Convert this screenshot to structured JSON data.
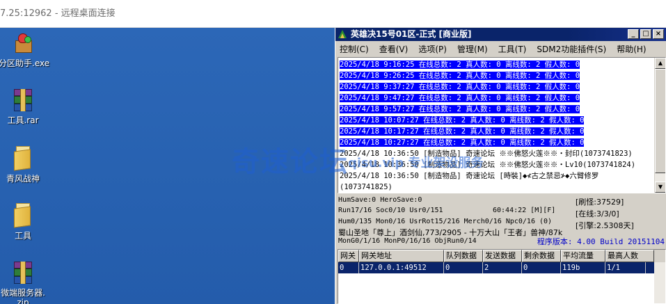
{
  "rdp": {
    "title": "7.25:12962 - 远程桌面连接"
  },
  "desktop": {
    "icons": [
      {
        "label": "分区助手.exe",
        "icon": "gift-box-icon"
      },
      {
        "label": "工具.rar",
        "icon": "winrar-icon"
      },
      {
        "label": "青风战神",
        "icon": "folder-icon"
      },
      {
        "label": "工具",
        "icon": "folder-icon"
      },
      {
        "label": "微端服务器.",
        "label2": "zip",
        "icon": "winrar-icon"
      }
    ]
  },
  "window": {
    "title": "英雄决15号01区-正式 [商业版]",
    "buttons": {
      "minimize": "_",
      "maximize": "□",
      "close": "×"
    },
    "menu": [
      "控制(C)",
      "查看(V)",
      "选项(P)",
      "管理(M)",
      "工具(T)",
      "SDM2功能插件(S)",
      "帮助(H)"
    ],
    "log": [
      {
        "text": "2025/4/18 9:16:25 在线总数: 2 真人数: 0 离线数: 2 假人数: 0",
        "highlight": true
      },
      {
        "text": "2025/4/18 9:26:25 在线总数: 2 真人数: 0 离线数: 2 假人数: 0",
        "highlight": true
      },
      {
        "text": "2025/4/18 9:37:27 在线总数: 2 真人数: 0 离线数: 2 假人数: 0",
        "highlight": true
      },
      {
        "text": "2025/4/18 9:47:27 在线总数: 2 真人数: 0 离线数: 2 假人数: 0",
        "highlight": true
      },
      {
        "text": "2025/4/18 9:57:27 在线总数: 2 真人数: 0 离线数: 2 假人数: 0",
        "highlight": true
      },
      {
        "text": "2025/4/18 10:07:27 在线总数: 2 真人数: 0 离线数: 2 假人数: 0",
        "highlight": true
      },
      {
        "text": "2025/4/18 10:17:27 在线总数: 2 真人数: 0 离线数: 2 假人数: 0",
        "highlight": true
      },
      {
        "text": "2025/4/18 10:27:27 在线总数: 2 真人数: 0 离线数: 2 假人数: 0",
        "highlight": true
      },
      {
        "text": "2025/4/18 10:36:50 [制造物品] 奇速论坛 ※※佛怒火莲※※・封印(1073741823)",
        "highlight": false
      },
      {
        "text": "2025/4/18 10:36:50 [制造物品] 奇速论坛 ※※佛怒火莲※※・Lv10(1073741824)",
        "highlight": false
      },
      {
        "text": "2025/4/18 10:36:50 [制造物品] 奇速论坛 [時裝]◆≮古之禁忌≯◆六臂修罗",
        "highlight": false
      },
      {
        "text": "(1073741825)",
        "highlight": false
      }
    ],
    "status": {
      "line1": "HumSave:0 HeroSave:0",
      "line2_left": "Run17/16 Soc0/10 Usr0/151",
      "line2_right": "60:44:22 [M][F]",
      "line3": "Hum0/135 Mon0/16 UsrRot15/216 Merch0/16 Npc0/16 (0)",
      "line4": "蜀山圣地「尊上」酒剑仙,773/2905 - 十万大山「王者」兽神/87k",
      "line5": "MonG0/1/16 MonP0/16/16 ObjRun0/14",
      "refresh": "[刷怪:37529]",
      "online": "[在线:3/3/0]",
      "engine": "[引擎:2.5308天]",
      "version": "程序版本: 4.00 Build 20151104"
    },
    "grid": {
      "headers": [
        "网关",
        "网关地址",
        "队列数据",
        "发送数据",
        "剩余数据",
        "平均流量",
        "最高人数"
      ],
      "rows": [
        [
          "0",
          "127.0.0.1:49512",
          "0",
          "2",
          "0",
          "119b",
          "1/1"
        ]
      ]
    }
  },
  "watermark": {
    "main": "奇速论坛",
    "sub": "qisu.vip 专业架设服务"
  }
}
